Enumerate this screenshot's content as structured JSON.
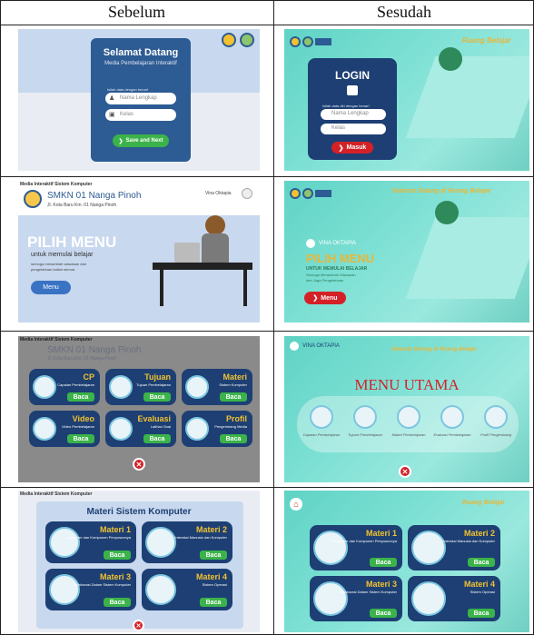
{
  "table": {
    "col_before": "Sebelum",
    "col_after": "Sesudah"
  },
  "before_login": {
    "title": "Selamat Datang",
    "subtitle": "Media Pembelajaran Interaktif",
    "instruction": "Isilah data dengan benar!",
    "name_placeholder": "Nama Lengkap",
    "class_placeholder": "Kelas",
    "submit": "Save and Next"
  },
  "after_login": {
    "brand": "Ruang Belajar",
    "title": "LOGIN",
    "instruction": "Isilah data diri dengan benar!",
    "name_placeholder": "Nama Lengkap",
    "class_placeholder": "Kelas",
    "submit": "Masuk"
  },
  "before_menu": {
    "app_title": "Media Interaktif Sistem Komputer",
    "school": "SMKN 01 Nanga Pinoh",
    "address": "Jl. Kota Baru Km. 01 Nanga Pinoh",
    "user": "Vina Oktapia",
    "heading": "PILIH MENU",
    "sub": "untuk memulai belajar",
    "desc1": "semoga menambah wawasan dan",
    "desc2": "pengetahuan kalian semua",
    "button": "Menu"
  },
  "after_menu": {
    "greeting": "Selamat Datang di Ruang Belajar",
    "user": "VINA OKTAPIA",
    "heading": "PILIH MENU",
    "sub": "UNTUK MEMULAI BELAJAR",
    "desc1": "Semoga Menambah Wawasan",
    "desc2": "dan Juga Pengetahuan",
    "button": "Menu"
  },
  "before_main": {
    "app_title": "Media Interaktif Sistem Komputer",
    "school": "SMKN 01 Nanga Pinoh",
    "address": "Jl. Kota Baru Km. 01 Nanga Pinoh",
    "cards": [
      {
        "title": "CP",
        "desc": "Capaian Pembelajaran",
        "action": "Baca"
      },
      {
        "title": "Tujuan",
        "desc": "Tujuan Pembelajaran",
        "action": "Baca"
      },
      {
        "title": "Materi",
        "desc": "Sistem Komputer",
        "action": "Baca"
      },
      {
        "title": "Video",
        "desc": "Video Pembelajaran",
        "action": "Baca"
      },
      {
        "title": "Evaluasi",
        "desc": "Latihan Soal",
        "action": "Baca"
      },
      {
        "title": "Profil",
        "desc": "Pengembang Media",
        "action": "Baca"
      }
    ]
  },
  "after_main": {
    "user": "VINA OKTAPIA",
    "greeting": "Selamat Datang di Ruang Belajar",
    "heading": "MENU UTAMA",
    "items": [
      "Capaian Pembelajaran",
      "Tujuan Pembelajaran",
      "Materi Pembelajaran",
      "Evaluasi Pembelajaran",
      "Profil Pengembang"
    ]
  },
  "before_materi": {
    "app_title": "Media Interaktif Sistem Komputer",
    "heading": "Materi Sistem Komputer",
    "cards": [
      {
        "title": "Materi 1",
        "desc": "Komputer dan Komponen Penyusunnya",
        "action": "Baca"
      },
      {
        "title": "Materi 2",
        "desc": "Interaksi Manusia dan Komputer",
        "action": "Baca"
      },
      {
        "title": "Materi 3",
        "desc": "Kolaborasi Dalam Sistem Komputer",
        "action": "Baca"
      },
      {
        "title": "Materi 4",
        "desc": "Sistem Operasi",
        "action": "Baca"
      }
    ]
  },
  "after_materi": {
    "brand": "Ruang Belajar",
    "cards": [
      {
        "title": "Materi 1",
        "desc": "Komputer dan Komponen Penyusunnya",
        "action": "Baca"
      },
      {
        "title": "Materi 2",
        "desc": "Interaksi Manusia dan Komputer",
        "action": "Baca"
      },
      {
        "title": "Materi 3",
        "desc": "Kolaborasi Dalam Sistem Komputer",
        "action": "Baca"
      },
      {
        "title": "Materi 4",
        "desc": "Sistem Operasi",
        "action": "Baca"
      }
    ]
  },
  "colors": {
    "navy": "#1d3f73",
    "teal": "#6fd6c9",
    "green": "#3bb34a",
    "red": "#d42127"
  }
}
